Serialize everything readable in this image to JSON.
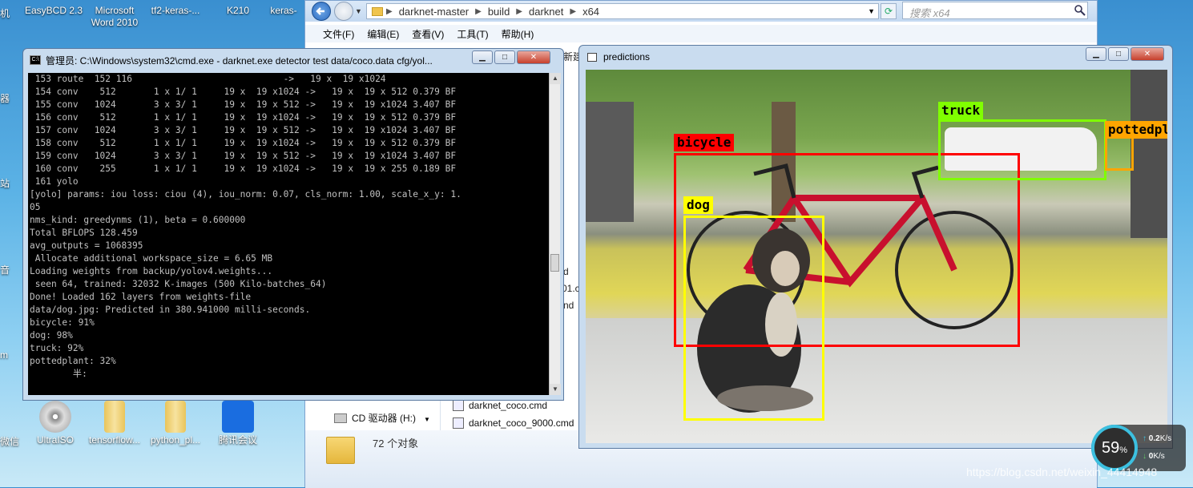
{
  "desktop": {
    "top_icons": [
      "EasyBCD 2.3",
      "Microsoft Word 2010",
      "tf2-keras-...",
      "K210",
      "keras-"
    ],
    "bottom_icons": [
      "UltraISO",
      "tensorflow...",
      "python_pl...",
      "腾讯会议"
    ],
    "left_edge_labels": [
      "机",
      "器",
      "站",
      "音",
      "m",
      "微信"
    ]
  },
  "explorer": {
    "breadcrumbs": [
      "darknet-master",
      "build",
      "darknet",
      "x64"
    ],
    "search_placeholder": "搜索 x64",
    "menu": [
      "文件(F)",
      "编辑(E)",
      "查看(V)",
      "工具(T)",
      "帮助(H)"
    ],
    "partial_text": [
      "新建",
      "d",
      "01.cr",
      "nd"
    ],
    "drive_label": "CD 驱动器 (H:)",
    "files": [
      "darknet_coco.cmd",
      "darknet_coco_9000.cmd"
    ],
    "status": "72 个对象"
  },
  "cmd": {
    "title": "管理员: C:\\Windows\\system32\\cmd.exe - darknet.exe  detector test data/coco.data cfg/yol...",
    "lines": [
      " 153 route  152 116                            ->   19 x  19 x1024",
      " 154 conv    512       1 x 1/ 1     19 x  19 x1024 ->   19 x  19 x 512 0.379 BF",
      " 155 conv   1024       3 x 3/ 1     19 x  19 x 512 ->   19 x  19 x1024 3.407 BF",
      " 156 conv    512       1 x 1/ 1     19 x  19 x1024 ->   19 x  19 x 512 0.379 BF",
      " 157 conv   1024       3 x 3/ 1     19 x  19 x 512 ->   19 x  19 x1024 3.407 BF",
      " 158 conv    512       1 x 1/ 1     19 x  19 x1024 ->   19 x  19 x 512 0.379 BF",
      " 159 conv   1024       3 x 3/ 1     19 x  19 x 512 ->   19 x  19 x1024 3.407 BF",
      " 160 conv    255       1 x 1/ 1     19 x  19 x1024 ->   19 x  19 x 255 0.189 BF",
      " 161 yolo",
      "[yolo] params: iou loss: ciou (4), iou_norm: 0.07, cls_norm: 1.00, scale_x_y: 1.",
      "05",
      "nms_kind: greedynms (1), beta = 0.600000",
      "Total BFLOPS 128.459",
      "avg_outputs = 1068395",
      " Allocate additional workspace_size = 6.65 MB",
      "Loading weights from backup/yolov4.weights...",
      " seen 64, trained: 32032 K-images (500 Kilo-batches_64)",
      "Done! Loaded 162 layers from weights-file",
      "data/dog.jpg: Predicted in 380.941000 milli-seconds.",
      "bicycle: 91%",
      "dog: 98%",
      "truck: 92%",
      "pottedplant: 32%",
      "",
      "        半:"
    ]
  },
  "predictions": {
    "title": "predictions",
    "detections": [
      {
        "label": "bicycle",
        "color": "#ff0000"
      },
      {
        "label": "truck",
        "color": "#80ff00"
      },
      {
        "label": "pottedpla",
        "color": "#ffa500"
      },
      {
        "label": "dog",
        "color": "#ffff00"
      }
    ]
  },
  "perf": {
    "cpu": "59",
    "cpu_unit": "%",
    "up": "0.2",
    "up_unit": "K/s",
    "down": "0",
    "down_unit": "K/s"
  },
  "watermark": "https://blog.csdn.net/weixin_44414948"
}
